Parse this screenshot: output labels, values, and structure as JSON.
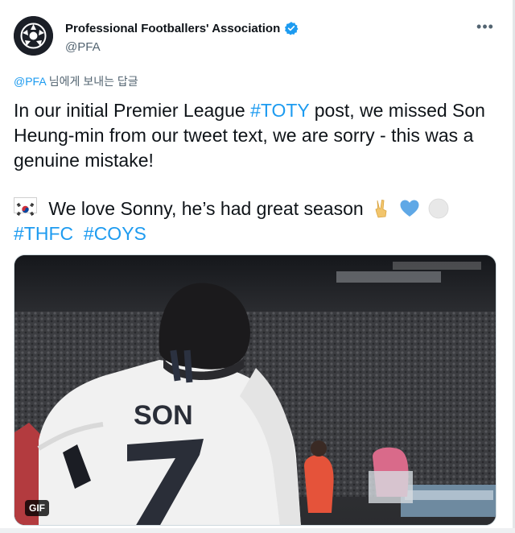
{
  "author": {
    "display_name": "Professional Footballers' Association",
    "handle": "@PFA",
    "verified": true,
    "avatar_icon": "pfa-logo"
  },
  "more_label": "•••",
  "reply": {
    "mention": "@PFA",
    "suffix": " 님에게 보내는 답글"
  },
  "tweet": {
    "p1_a": "In our initial Premier League ",
    "p1_hashtag": "#TOTY",
    "p1_b": " post, we missed Son Heung-min from our tweet text, we are sorry - this was a genuine mistake!",
    "p2_flag": "south-korea-flag",
    "p2_text": " We love Sonny, he’s had great season",
    "p2_emojis": [
      "victory-hand-emoji",
      "blue-heart-emoji",
      "white-circle-emoji"
    ],
    "hashtags": [
      "#THFC",
      "#COYS"
    ]
  },
  "media": {
    "type": "gif",
    "badge": "GIF",
    "shirt_name": "SON",
    "shirt_number": "7"
  },
  "colors": {
    "link_blue": "#1d9bf0",
    "secondary_text": "#536471",
    "heart_blue": "#5fa8e6"
  }
}
